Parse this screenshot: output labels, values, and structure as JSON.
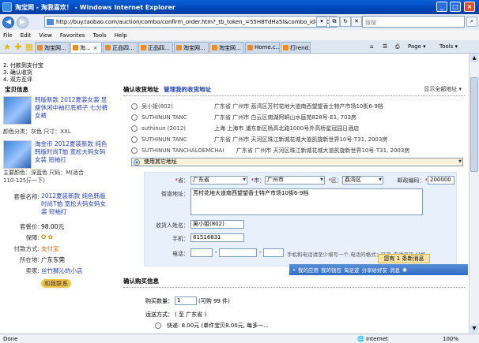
{
  "window": {
    "title": "淘宝网 - 淘我喜欢！ - Windows Internet Explorer"
  },
  "address_bar": {
    "url": "http://buy.taobao.com/auction/combo/confirm_order.htm?_tb_token_=55H8TdHa5l&combo_id=7800986&quantity=1&tb",
    "search_placeholder": "搜搜"
  },
  "menu": [
    "File",
    "Edit",
    "View",
    "Favorites",
    "Tools",
    "Help"
  ],
  "tabs": [
    "淘宝网...",
    "淘...",
    "正品四...",
    "正品四...",
    "淘宝网...",
    "淘宝网...",
    "Home.c...",
    "打rend..."
  ],
  "toolbar_right": {
    "page": "Page",
    "tools": "Tools"
  },
  "steps": [
    "2. 付款到支付宝",
    "3. 确认收货",
    "4. 双方互评"
  ],
  "left_panel": {
    "title": "宝贝信息",
    "item1": {
      "name": "韩版新款 2012夏装女装 显瘦休闲中袖打底裤子 七分裤 女裤",
      "attr": "颜色分类：灰色 尺寸：XXL"
    },
    "item2": {
      "name": "淘金币 2012夏装新款 纯色韩版时尚T恤 宽松大码女码女装 短袖打",
      "attr1": "主要颜色：深蓝色 尺码：M(适合",
      "attr2": "110-125斤一下)"
    },
    "package_label": "套餐名称:",
    "package_name": "2012夏装新款 纯色韩版时尚T恤 宽松大码女码女装 短袖打",
    "price_label": "套餐价:",
    "price_value": "98.00元",
    "guarantee_label": "保障:",
    "payment_label": "付款方式:",
    "payment_value": "支付宝",
    "location_label": "所在地:",
    "location_value": "广东东莞",
    "seller_label": "卖家:",
    "seller_value": "丝竹狮沁的小店",
    "contact": "和我联系"
  },
  "address_section": {
    "title": "确认收货地址",
    "manage": "管理我的收货地址",
    "show_all": "显示全部地址",
    "addresses": [
      {
        "name": "吴小姐(802)",
        "addr": "广东省 广州市 荔湾区芳村花地大道南西望望香士特产市场10街6-9档"
      },
      {
        "name": "SUTHINUN TANC",
        "addr": "广东省 广州市 白云区南湖阿峒山水庭苑828号-E1, 703房"
      },
      {
        "name": "suthinun (2012)",
        "addr": "上海 上海市 浦东新区杨高北路1000号外高桥星冠园日酒店"
      },
      {
        "name": "SUTHINUN TANC",
        "addr": "广东省 广州市 天河区珠江新城花城大道凯旋新世界10号-T31, 2003房"
      },
      {
        "name": "SUTHINUN TANCHALOEMCHAI",
        "addr": "广东省 广州市 天河区珠江新城花城大道凯旋新世界10号-T31, 2003房"
      }
    ],
    "other": "使用其它地址"
  },
  "form": {
    "province_label": "省：",
    "province_value": "广东省",
    "city_label": "市：",
    "city_value": "广州市",
    "district_label": "区：",
    "district_value": "荔湾区",
    "zip_label": "邮政编码：",
    "zip_value": "200000",
    "street_label": "街道地址：",
    "street_value": "芳村花地大道南西望望香士特产市场10街6-9档",
    "receiver_label": "收货人姓名：",
    "receiver_value": "吴小姐(802)",
    "mobile_label": "手机：",
    "mobile_value": "81516831",
    "phone_label": "电话：",
    "phone_hint": "手机和电话请至少填写一个,电话的格式：区号-电话号码-分机"
  },
  "buy_section": {
    "title": "确认购买信息",
    "qty_label": "购买数量：",
    "qty_value": "1",
    "qty_hint": "(可购 99 件)",
    "ship_label": "运送方式：",
    "ship_hint": "( 至 广东省 )",
    "express": "快递: 8.00元 (单件宝贝8.00元, 每多一..."
  },
  "notice": "您有 1 条新消息",
  "bottom_bar": [
    "我的应用",
    "我的钱包",
    "淘足迹",
    "分享给好友",
    "消息"
  ],
  "status": {
    "done": "Done",
    "zone": "Internet",
    "zoom": "100%"
  }
}
